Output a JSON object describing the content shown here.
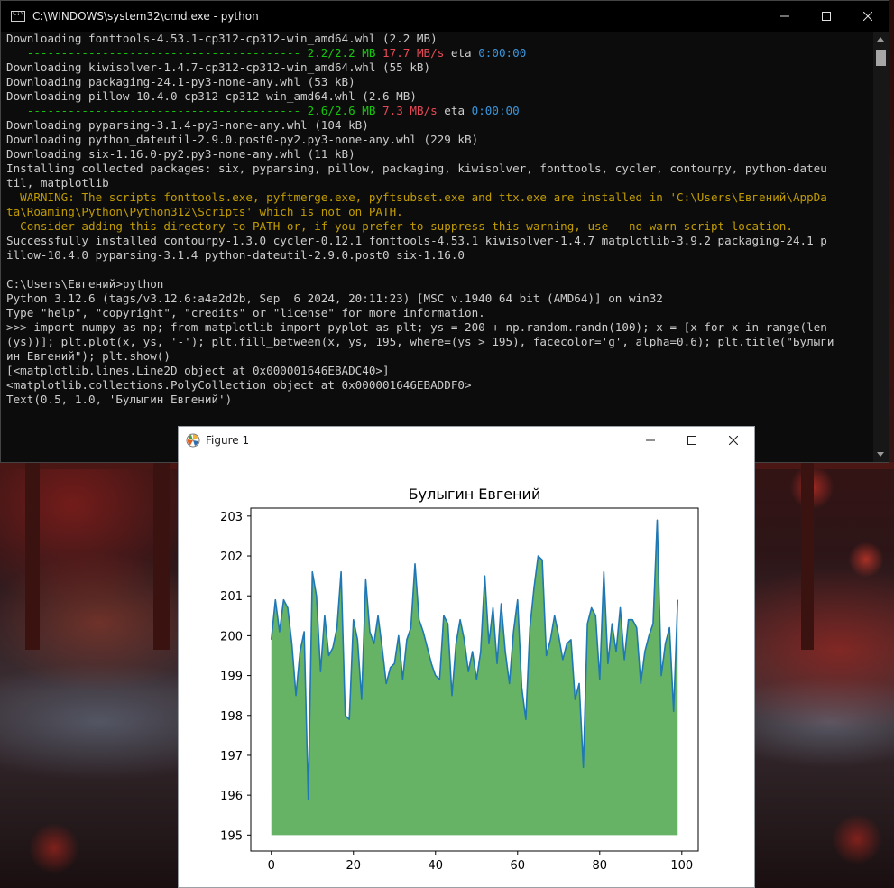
{
  "cmd": {
    "title": "C:\\WINDOWS\\system32\\cmd.exe - python",
    "lines": [
      [
        {
          "t": "Downloading fonttools-4.53.1-cp312-cp312-win_amd64.whl (2.2 MB)"
        }
      ],
      [
        {
          "t": "   ---------------------------------------- ",
          "c": "green"
        },
        {
          "t": "2.2/2.2 MB ",
          "c": "green"
        },
        {
          "t": "17.7 MB/s",
          "c": "red"
        },
        {
          "t": " eta "
        },
        {
          "t": "0:00:00",
          "c": "cyan"
        }
      ],
      [
        {
          "t": "Downloading kiwisolver-1.4.7-cp312-cp312-win_amd64.whl (55 kB)"
        }
      ],
      [
        {
          "t": "Downloading packaging-24.1-py3-none-any.whl (53 kB)"
        }
      ],
      [
        {
          "t": "Downloading pillow-10.4.0-cp312-cp312-win_amd64.whl (2.6 MB)"
        }
      ],
      [
        {
          "t": "   ---------------------------------------- ",
          "c": "green"
        },
        {
          "t": "2.6/2.6 MB ",
          "c": "green"
        },
        {
          "t": "7.3 MB/s",
          "c": "red"
        },
        {
          "t": " eta "
        },
        {
          "t": "0:00:00",
          "c": "cyan"
        }
      ],
      [
        {
          "t": "Downloading pyparsing-3.1.4-py3-none-any.whl (104 kB)"
        }
      ],
      [
        {
          "t": "Downloading python_dateutil-2.9.0.post0-py2.py3-none-any.whl (229 kB)"
        }
      ],
      [
        {
          "t": "Downloading six-1.16.0-py2.py3-none-any.whl (11 kB)"
        }
      ],
      [
        {
          "t": "Installing collected packages: six, pyparsing, pillow, packaging, kiwisolver, fonttools, cycler, contourpy, python-dateu"
        }
      ],
      [
        {
          "t": "til, matplotlib"
        }
      ],
      [
        {
          "t": "  WARNING: The scripts fonttools.exe, pyftmerge.exe, pyftsubset.exe and ttx.exe are installed in 'C:\\Users\\Евгений\\AppDa",
          "c": "yellow"
        }
      ],
      [
        {
          "t": "ta\\Roaming\\Python\\Python312\\Scripts' which is not on PATH.",
          "c": "yellow"
        }
      ],
      [
        {
          "t": "  Consider adding this directory to PATH or, if you prefer to suppress this warning, use --no-warn-script-location.",
          "c": "yellow"
        }
      ],
      [
        {
          "t": "Successfully installed contourpy-1.3.0 cycler-0.12.1 fonttools-4.53.1 kiwisolver-1.4.7 matplotlib-3.9.2 packaging-24.1 p"
        }
      ],
      [
        {
          "t": "illow-10.4.0 pyparsing-3.1.4 python-dateutil-2.9.0.post0 six-1.16.0"
        }
      ],
      [
        {
          "t": ""
        }
      ],
      [
        {
          "t": "C:\\Users\\Евгений>python"
        }
      ],
      [
        {
          "t": "Python 3.12.6 (tags/v3.12.6:a4a2d2b, Sep  6 2024, 20:11:23) [MSC v.1940 64 bit (AMD64)] on win32"
        }
      ],
      [
        {
          "t": "Type \"help\", \"copyright\", \"credits\" or \"license\" for more information."
        }
      ],
      [
        {
          "t": ">>> import numpy as np; from matplotlib import pyplot as plt; ys = 200 + np.random.randn(100); x = [x for x in range(len"
        }
      ],
      [
        {
          "t": "(ys))]; plt.plot(x, ys, '-'); plt.fill_between(x, ys, 195, where=(ys > 195), facecolor='g', alpha=0.6); plt.title(\"Булыги"
        }
      ],
      [
        {
          "t": "ин Евгений\"); plt.show()"
        }
      ],
      [
        {
          "t": "[<matplotlib.lines.Line2D object at 0x000001646EBADC40>]"
        }
      ],
      [
        {
          "t": "<matplotlib.collections.PolyCollection object at 0x000001646EBADDF0>"
        }
      ],
      [
        {
          "t": "Text(0.5, 1.0, 'Булыгин Евгений')"
        }
      ]
    ]
  },
  "figure_window": {
    "title": "Figure 1"
  },
  "chart_data": {
    "type": "area",
    "title": "Булыгин Евгений",
    "xlabel": "",
    "ylabel": "",
    "xlim": [
      -5,
      104
    ],
    "ylim": [
      194.6,
      203.2
    ],
    "xticks": [
      0,
      20,
      40,
      60,
      80,
      100
    ],
    "yticks": [
      195,
      196,
      197,
      198,
      199,
      200,
      201,
      202,
      203
    ],
    "fill_baseline": 195,
    "line_color": "#1f77b4",
    "fill_color": "#008000",
    "fill_alpha": 0.6,
    "grid": false,
    "x": [
      0,
      1,
      2,
      3,
      4,
      5,
      6,
      7,
      8,
      9,
      10,
      11,
      12,
      13,
      14,
      15,
      16,
      17,
      18,
      19,
      20,
      21,
      22,
      23,
      24,
      25,
      26,
      27,
      28,
      29,
      30,
      31,
      32,
      33,
      34,
      35,
      36,
      37,
      38,
      39,
      40,
      41,
      42,
      43,
      44,
      45,
      46,
      47,
      48,
      49,
      50,
      51,
      52,
      53,
      54,
      55,
      56,
      57,
      58,
      59,
      60,
      61,
      62,
      63,
      64,
      65,
      66,
      67,
      68,
      69,
      70,
      71,
      72,
      73,
      74,
      75,
      76,
      77,
      78,
      79,
      80,
      81,
      82,
      83,
      84,
      85,
      86,
      87,
      88,
      89,
      90,
      91,
      92,
      93,
      94,
      95,
      96,
      97,
      98,
      99
    ],
    "values": [
      199.9,
      200.9,
      200.1,
      200.9,
      200.7,
      199.8,
      198.5,
      199.6,
      200.1,
      195.9,
      201.6,
      201.0,
      199.1,
      200.5,
      199.5,
      199.7,
      200.2,
      201.6,
      198.0,
      197.9,
      200.4,
      199.9,
      198.4,
      201.4,
      200.1,
      199.8,
      200.5,
      199.7,
      198.8,
      199.2,
      199.3,
      200.0,
      198.9,
      199.9,
      200.2,
      201.8,
      200.4,
      200.1,
      199.7,
      199.3,
      199.0,
      198.9,
      200.5,
      200.3,
      198.5,
      199.8,
      200.4,
      199.9,
      199.1,
      199.6,
      198.9,
      199.6,
      201.5,
      199.8,
      200.7,
      199.3,
      200.8,
      199.6,
      198.8,
      200.1,
      200.9,
      198.7,
      197.9,
      200.2,
      201.2,
      202.0,
      201.9,
      199.5,
      199.9,
      200.5,
      200.0,
      199.4,
      199.8,
      199.9,
      198.4,
      198.8,
      196.7,
      200.3,
      200.7,
      200.5,
      198.9,
      201.6,
      199.3,
      200.3,
      199.6,
      200.7,
      199.4,
      200.4,
      200.4,
      200.2,
      198.8,
      199.6,
      200.0,
      200.3,
      202.9,
      199.0,
      199.8,
      200.2,
      198.1,
      200.9
    ]
  }
}
